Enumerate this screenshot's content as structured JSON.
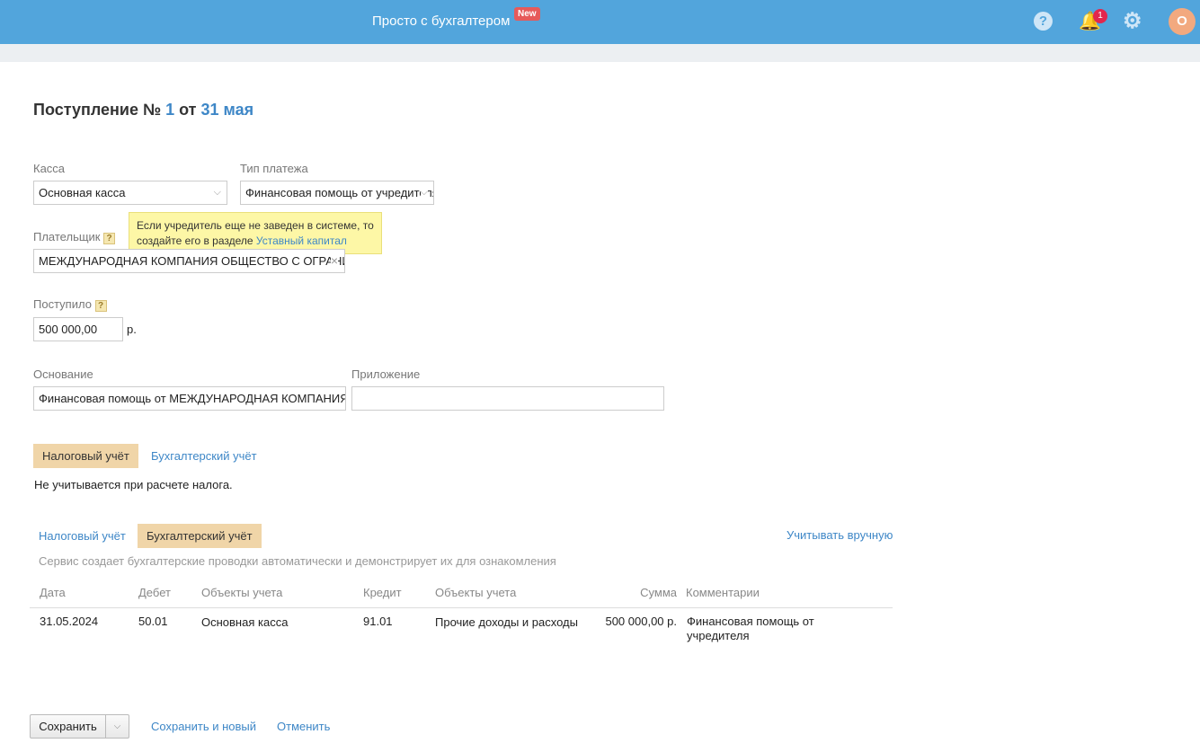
{
  "header": {
    "brand": "Просто с бухгалтером",
    "new_badge": "New",
    "notifications": "1",
    "avatar": "О"
  },
  "title": {
    "prefix": "Поступление №",
    "number": "1",
    "from": "от",
    "date": "31 мая"
  },
  "form": {
    "kassa_label": "Касса",
    "kassa_value": "Основная касса",
    "payment_type_label": "Тип платежа",
    "payment_type_value": "Финансовая помощь от учредителя",
    "payer_label": "Плательщик",
    "payer_value": "МЕЖДУНАРОДНАЯ КОМПАНИЯ ОБЩЕСТВО С ОГРАНИЧЕННОЙ ОТВЕТСТВЕННОСТЬЮ",
    "tooltip_text": "Если учредитель еще не заведен в системе, то создайте его в разделе",
    "tooltip_link": "Уставный капитал",
    "received_label": "Поступило",
    "received_value": "500 000,00",
    "currency": "р.",
    "basis_label": "Основание",
    "basis_value": "Финансовая помощь от МЕЖДУНАРОДНАЯ КОМПАНИЯ",
    "attachment_label": "Приложение",
    "attachment_value": ""
  },
  "tax_tabs": {
    "tax": "Налоговый учёт",
    "accounting": "Бухгалтерский учёт",
    "note": "Не учитывается при расчете налога."
  },
  "acc_tabs": {
    "tax": "Налоговый учёт",
    "accounting": "Бухгалтерский учёт",
    "manual": "Учитывать вручную",
    "note": "Сервис создает бухгалтерские проводки автоматически и демонстрирует их для ознакомления"
  },
  "table": {
    "headers": [
      "Дата",
      "Дебет",
      "Объекты учета",
      "Кредит",
      "Объекты учета",
      "Сумма",
      "Комментарии"
    ],
    "rows": [
      [
        "31.05.2024",
        "50.01",
        "Основная касса",
        "91.01",
        "Прочие доходы и расходы",
        "500 000,00 р.",
        "Финансовая помощь от учредителя"
      ]
    ]
  },
  "footer": {
    "save": "Сохранить",
    "save_new": "Сохранить и новый",
    "cancel": "Отменить"
  }
}
